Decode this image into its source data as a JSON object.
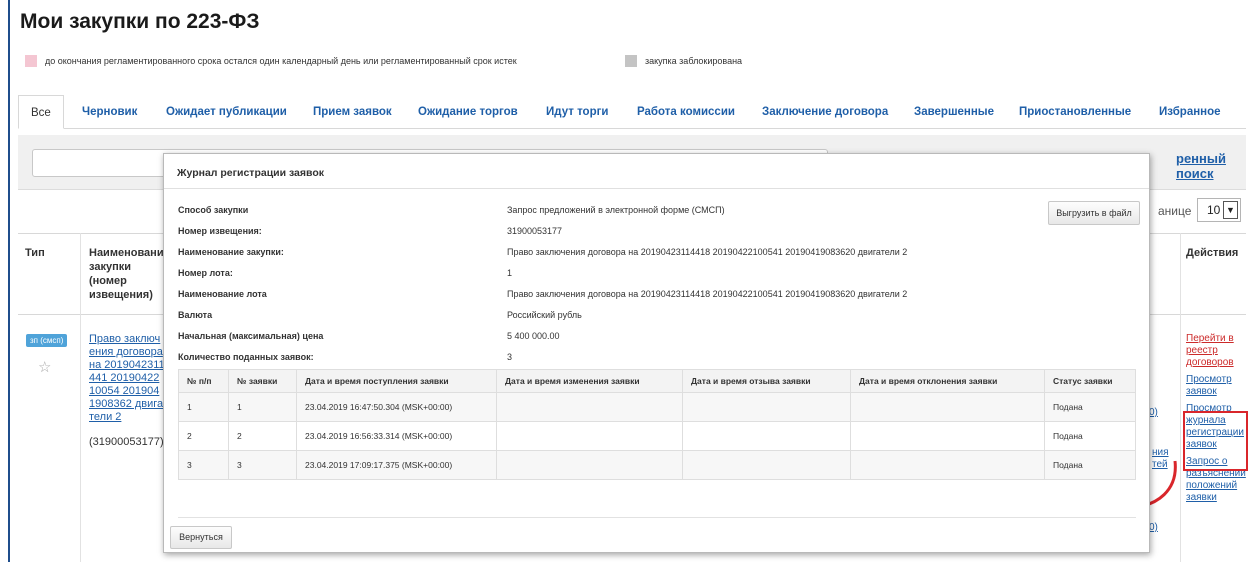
{
  "page": {
    "title": "Мои закупки по 223-ФЗ"
  },
  "legend": [
    {
      "text": "до окончания регламентированного срока остался один календарный день или регламентированный срок истек",
      "color": "#f4c6d2"
    },
    {
      "text": "закупка заблокирована",
      "color": "#c4c4c4"
    }
  ],
  "tabs": [
    "Все",
    "Черновик",
    "Ожидает публикации",
    "Прием заявок",
    "Ожидание торгов",
    "Идут торги",
    "Работа комиссии",
    "Заключение договора",
    "Завершенные",
    "Приостановленные",
    "Избранное"
  ],
  "search": {
    "value": "",
    "advanced_label": "ренный поиск"
  },
  "pagination": {
    "label": "анице",
    "value": "10"
  },
  "table": {
    "headers": {
      "type": "Тип",
      "name": "Наименование закупки (номер извещения)",
      "actions": "Действия"
    },
    "row": {
      "badge": "зп (смсп)",
      "name": "Право заключения договора на 2019042311441 2019042210054 2019041908362 двигатели 2",
      "number": "(31900053177)",
      "actions": [
        {
          "label": "Перейти в реестр договоров",
          "highlight": true
        },
        {
          "label": "Просмотр заявок",
          "highlight": false
        },
        {
          "label": "Просмотр журнала регистрации заявок",
          "highlight": false
        },
        {
          "label": "Запрос о разъяснении положений заявки",
          "highlight": false
        }
      ],
      "underlay_fragments": [
        "0)",
        "ния",
        "тей",
        "0)"
      ]
    }
  },
  "modal": {
    "title": "Журнал регистрации заявок",
    "export_label": "Выгрузить в файл",
    "back_label": "Вернуться",
    "info": [
      {
        "label": "Способ закупки",
        "value": "Запрос предложений в электронной форме (СМСП)"
      },
      {
        "label": "Номер извещения:",
        "value": "31900053177"
      },
      {
        "label": "Наименование закупки:",
        "value": "Право заключения договора на 20190423114418 20190422100541 20190419083620 двигатели 2"
      },
      {
        "label": "Номер лота:",
        "value": "1"
      },
      {
        "label": "Наименование лота",
        "value": "Право заключения договора на 20190423114418 20190422100541 20190419083620 двигатели 2"
      },
      {
        "label": "Валюта",
        "value": "Российский рубль"
      },
      {
        "label": "Начальная (максимальная) цена",
        "value": "5 400 000.00"
      },
      {
        "label": "Количество поданных заявок:",
        "value": "3"
      }
    ],
    "columns": [
      "№ п/п",
      "№ заявки",
      "Дата и время поступления заявки",
      "Дата и время изменения заявки",
      "Дата и время отзыва заявки",
      "Дата и время отклонения заявки",
      "Статус заявки"
    ],
    "rows": [
      [
        "1",
        "1",
        "23.04.2019 16:47:50.304 (MSK+00:00)",
        "",
        "",
        "",
        "Подана"
      ],
      [
        "2",
        "2",
        "23.04.2019 16:56:33.314 (MSK+00:00)",
        "",
        "",
        "",
        "Подана"
      ],
      [
        "3",
        "3",
        "23.04.2019 17:09:17.375 (MSK+00:00)",
        "",
        "",
        "",
        "Подана"
      ]
    ]
  },
  "colors": {
    "link": "#1f5fa8",
    "badge": "#4fa3d9",
    "highlight": "#d9262b"
  }
}
